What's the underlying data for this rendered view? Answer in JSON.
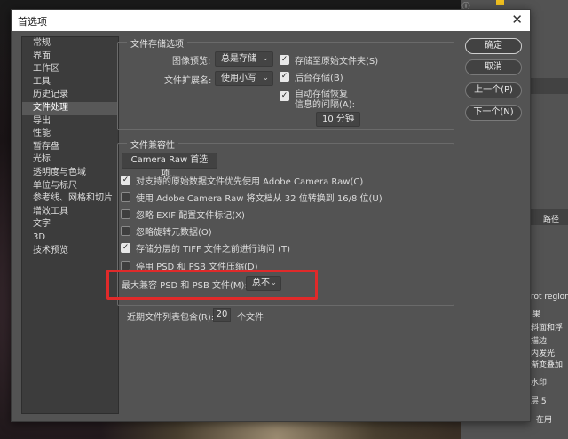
{
  "background": {
    "right_panel_items": [
      "rot region",
      "果",
      "斜面和浮",
      "描边",
      "内发光",
      "渐变叠加",
      "水印",
      "层 5",
      "在用",
      "路径"
    ]
  },
  "dialog": {
    "title": "首选项",
    "sidebar": {
      "items": [
        {
          "label": "常规",
          "selected": false
        },
        {
          "label": "界面",
          "selected": false
        },
        {
          "label": "工作区",
          "selected": false
        },
        {
          "label": "工具",
          "selected": false
        },
        {
          "label": "历史记录",
          "selected": false
        },
        {
          "label": "文件处理",
          "selected": true
        },
        {
          "label": "导出",
          "selected": false
        },
        {
          "label": "性能",
          "selected": false
        },
        {
          "label": "暂存盘",
          "selected": false
        },
        {
          "label": "光标",
          "selected": false
        },
        {
          "label": "透明度与色域",
          "selected": false
        },
        {
          "label": "单位与标尺",
          "selected": false
        },
        {
          "label": "参考线、网格和切片",
          "selected": false
        },
        {
          "label": "增效工具",
          "selected": false
        },
        {
          "label": "文字",
          "selected": false
        },
        {
          "label": "3D",
          "selected": false
        },
        {
          "label": "技术预览",
          "selected": false
        }
      ]
    },
    "file_save": {
      "title": "文件存储选项",
      "image_preview_label": "图像预览:",
      "image_preview_value": "总是存储",
      "extension_label": "文件扩展名:",
      "extension_value": "使用小写",
      "save_to_original": {
        "label": "存储至原始文件夹(S)",
        "checked": true
      },
      "background_save": {
        "label": "后台存储(B)",
        "checked": true
      },
      "auto_save": {
        "label_line1": "自动存储恢复",
        "label_line2": "信息的间隔(A):",
        "checked": true
      },
      "interval_value": "10 分钟"
    },
    "compat": {
      "title": "文件兼容性",
      "camera_raw_button": "Camera Raw 首选项...",
      "options": [
        {
          "label": "对支持的原始数据文件优先使用 Adobe Camera Raw(C)",
          "checked": true
        },
        {
          "label": "使用 Adobe Camera Raw 将文档从 32 位转换到 16/8 位(U)",
          "checked": false
        },
        {
          "label": "忽略 EXIF 配置文件标记(X)",
          "checked": false
        },
        {
          "label": "忽略旋转元数据(O)",
          "checked": false
        },
        {
          "label": "存储分层的 TIFF 文件之前进行询问 (T)",
          "checked": true
        },
        {
          "label": "停用 PSD 和 PSB 文件压缩(D)",
          "checked": false
        }
      ],
      "max_compat_label": "最大兼容 PSD 和 PSB 文件(M):",
      "max_compat_value": "总不"
    },
    "recent_files": {
      "label_before": "近期文件列表包含(R):",
      "value": "20",
      "label_after": "个文件"
    },
    "buttons": {
      "ok": "确定",
      "cancel": "取消",
      "prev": "上一个(P)",
      "next": "下一个(N)"
    },
    "highlight_color": "#e02a2a"
  }
}
